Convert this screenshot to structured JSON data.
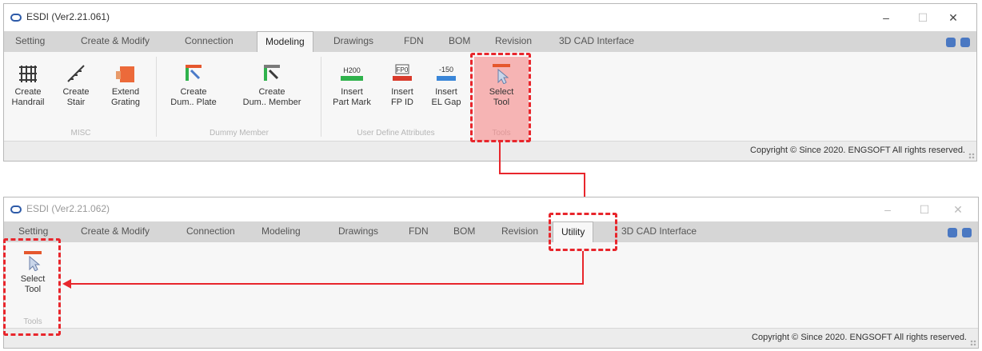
{
  "window1": {
    "title": "ESDI (Ver2.21.061)",
    "tabs": [
      "Setting",
      "Create & Modify",
      "Connection",
      "Modeling",
      "Drawings",
      "FDN",
      "BOM",
      "Revision",
      "3D CAD Interface"
    ],
    "active_tab": "Modeling",
    "groups": {
      "misc": {
        "label": "MISC",
        "buttons": [
          "Create\nHandrail",
          "Create\nStair",
          "Extend\nGrating"
        ]
      },
      "dummy": {
        "label": "Dummy Member",
        "buttons": [
          "Create\nDum.. Plate",
          "Create\nDum.. Member"
        ]
      },
      "uda": {
        "label": "User Define Attributes",
        "buttons": [
          "Insert\nPart Mark",
          "Insert\nFP ID",
          "Insert\nEL Gap"
        ],
        "icon_texts": [
          "H200",
          "FP0",
          "-150"
        ]
      },
      "tools": {
        "label": "Tools",
        "buttons": [
          "Select\nTool"
        ]
      }
    },
    "status": "Copyright © Since 2020. ENGSOFT All rights reserved."
  },
  "window2": {
    "title": "ESDI (Ver2.21.062)",
    "tabs": [
      "Setting",
      "Create & Modify",
      "Connection",
      "Modeling",
      "Drawings",
      "FDN",
      "BOM",
      "Revision",
      "Utility",
      "3D CAD Interface"
    ],
    "active_tab": "Utility",
    "groups": {
      "tools": {
        "label": "Tools",
        "buttons": [
          "Select\nTool"
        ]
      }
    },
    "status": "Copyright © Since 2020. ENGSOFT All rights reserved."
  },
  "window_controls": {
    "minimize": "–",
    "maximize": "☐",
    "close": "✕"
  },
  "colors": {
    "highlight": "#e8262c",
    "selected_bg": "#f6b4b4",
    "accent": "#4a78c2"
  }
}
